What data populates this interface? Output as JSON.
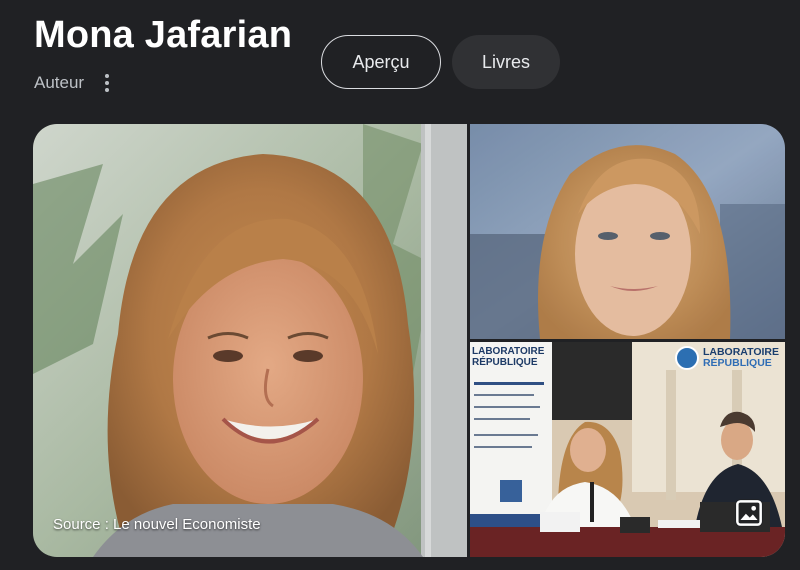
{
  "header": {
    "title": "Mona Jafarian",
    "subtitle": "Auteur",
    "more_options_icon": "more-vert-icon"
  },
  "chips": [
    {
      "label": "Aperçu",
      "selected": true
    },
    {
      "label": "Livres",
      "selected": false
    }
  ],
  "gallery": {
    "main_caption": "Source : Le nouvel Economiste",
    "bottom_logo": {
      "line1": "LABORATOIRE",
      "line2": "RÉPUBLIQUE"
    },
    "bottom_banner": {
      "line1": "LABORATOIRE",
      "line2": "RÉPUBLIQUE"
    },
    "image_icon": "image-icon"
  },
  "colors": {
    "background": "#202124",
    "chip_selected_border": "#dadce0",
    "chip_unselected_bg": "#303134",
    "text_primary": "#ffffff",
    "text_secondary": "#bdc1c6"
  }
}
